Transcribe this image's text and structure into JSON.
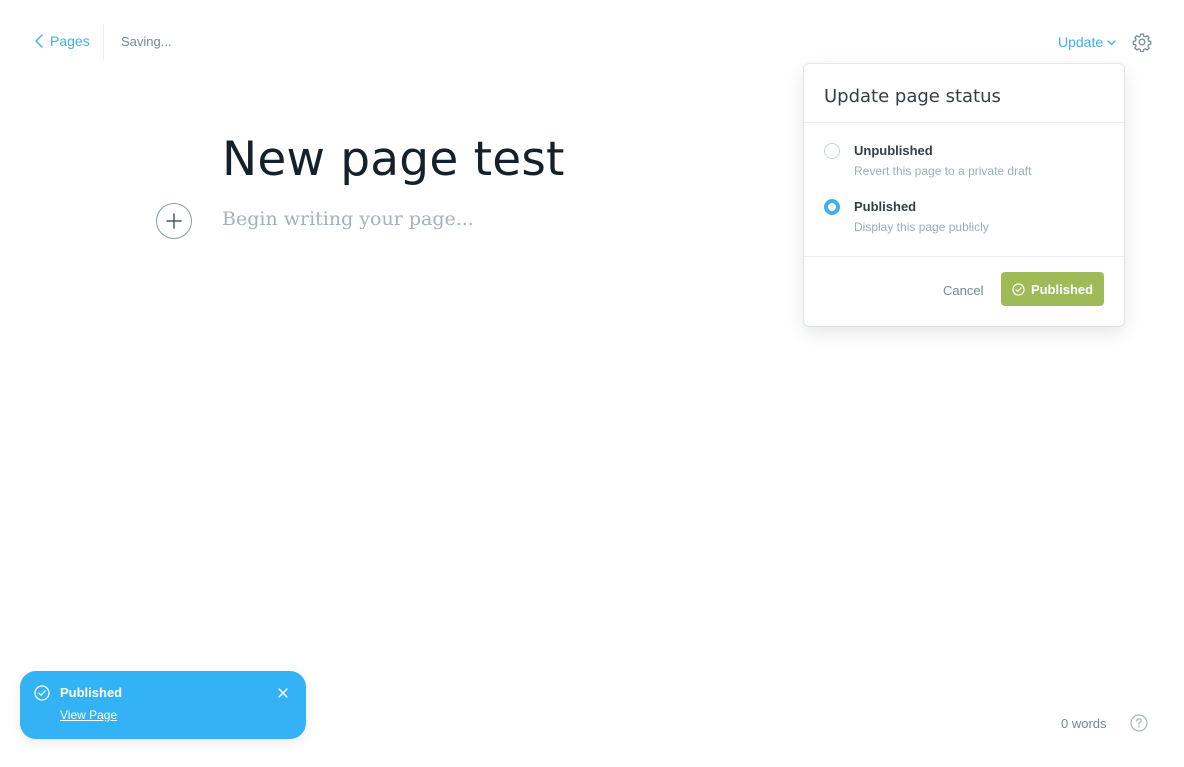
{
  "header": {
    "back_label": "Pages",
    "status_text": "Saving...",
    "update_label": "Update"
  },
  "editor": {
    "title": "New page test",
    "placeholder": "Begin writing your page..."
  },
  "status_popover": {
    "title": "Update page status",
    "options": [
      {
        "label": "Unpublished",
        "description": "Revert this page to a private draft",
        "selected": false
      },
      {
        "label": "Published",
        "description": "Display this page publicly",
        "selected": true
      }
    ],
    "cancel_label": "Cancel",
    "confirm_label": "Published"
  },
  "toast": {
    "title": "Published",
    "link_label": "View Page"
  },
  "footer": {
    "word_count": "0 words"
  },
  "colors": {
    "accent_blue": "#3eb0ef",
    "publish_green": "#9fbb58",
    "toast_blue": "#33b2f5"
  },
  "icons": [
    "chevron-left-icon",
    "chevron-down-icon",
    "gear-icon",
    "plus-icon",
    "check-circle-icon",
    "close-icon",
    "help-icon"
  ]
}
